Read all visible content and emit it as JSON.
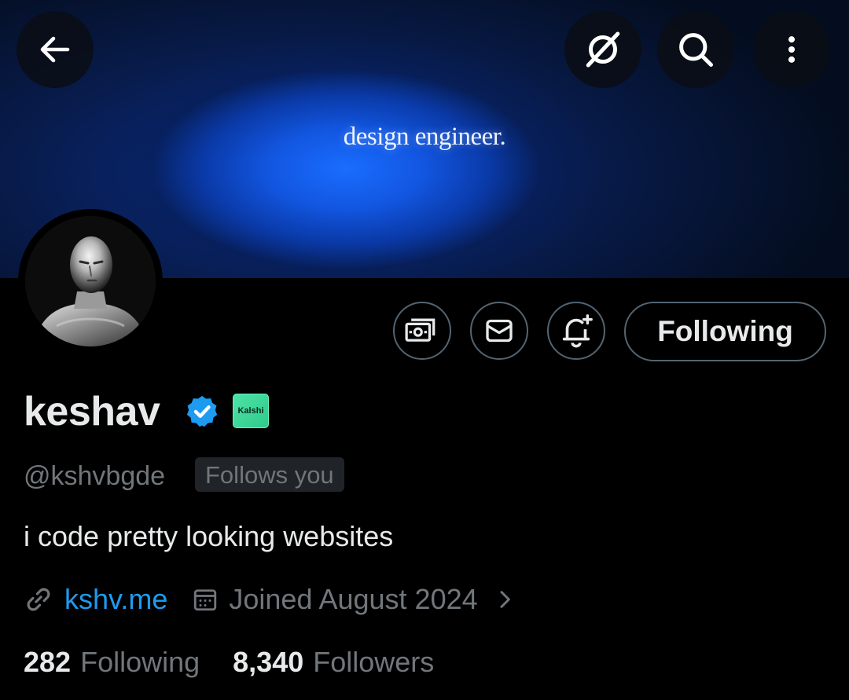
{
  "banner": {
    "text": "design engineer."
  },
  "top_actions": {
    "back_icon": "arrow-left-icon",
    "grok_icon": "grok-icon",
    "search_icon": "search-icon",
    "more_icon": "more-vertical-icon"
  },
  "profile_actions": {
    "tip_icon": "money-icon",
    "message_icon": "mail-icon",
    "notify_icon": "bell-plus-icon",
    "following_label": "Following"
  },
  "profile": {
    "name": "keshav",
    "verified_badge": "verified-badge-icon",
    "affiliation_badge": "Kalshi",
    "handle": "@kshvbgde",
    "follows_you": "Follows you",
    "bio": "i code pretty looking websites",
    "website": "kshv.me",
    "joined": "Joined August 2024"
  },
  "stats": {
    "following_count": "282",
    "following_label": "Following",
    "followers_count": "8,340",
    "followers_label": "Followers"
  },
  "colors": {
    "link": "#1d9bf0",
    "verified": "#1d9bf0",
    "secondary_text": "#71767b",
    "primary_text": "#e7e9ea",
    "background": "#000000",
    "kalshi": "#3ad89a"
  }
}
